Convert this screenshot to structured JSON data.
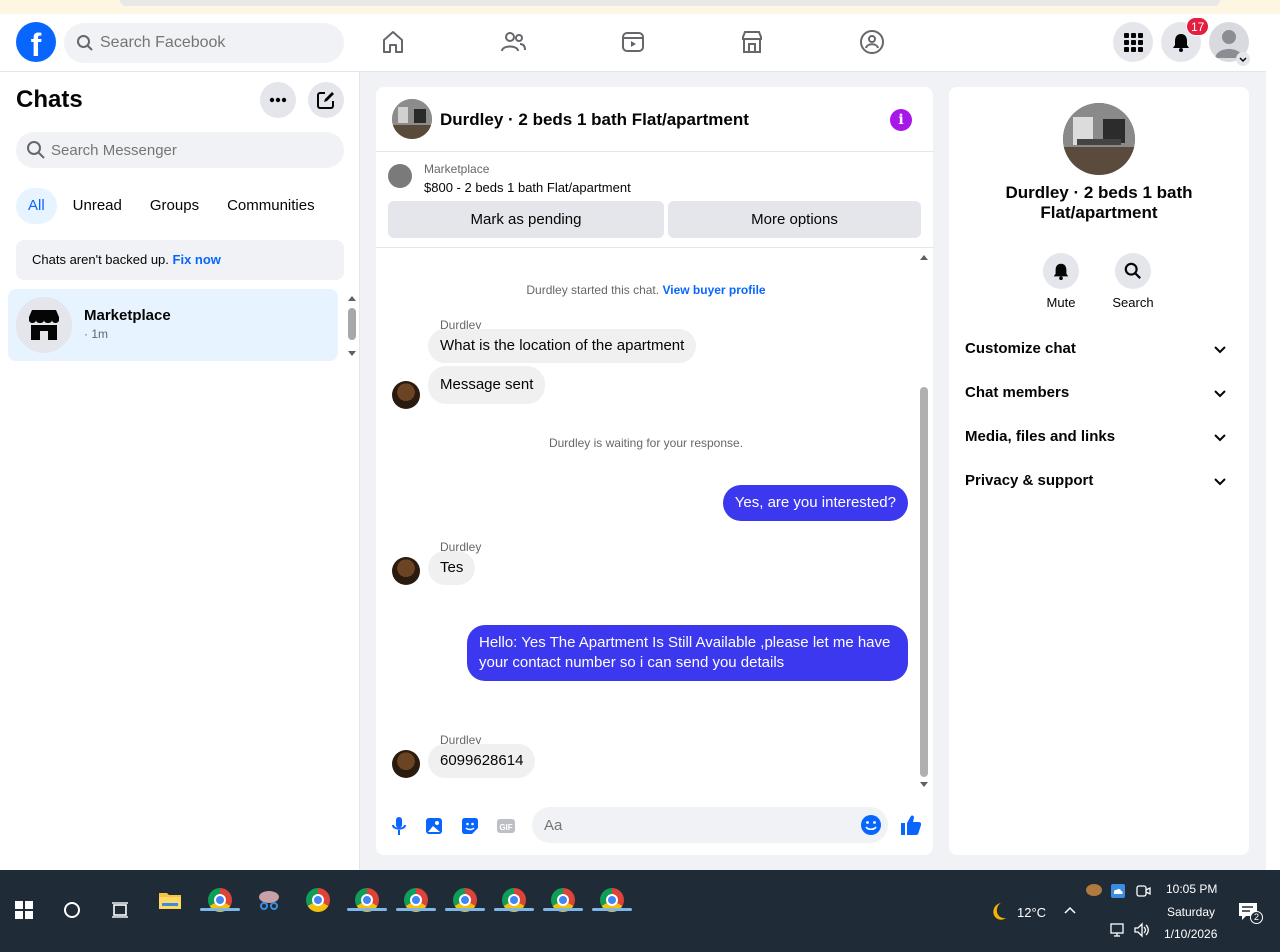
{
  "header": {
    "search_placeholder": "Search Facebook",
    "notifications_count": "17"
  },
  "left": {
    "title": "Chats",
    "search_placeholder": "Search Messenger",
    "filters": [
      "All",
      "Unread",
      "Groups",
      "Communities"
    ],
    "active_filter": "All",
    "backup_text": "Chats aren't backed up.",
    "backup_link": "Fix now",
    "conversation": {
      "name": "Marketplace",
      "time": "· 1m"
    }
  },
  "chat": {
    "title": "Durdley · 2 beds 1 bath Flat/apartment",
    "marketplace_label": "Marketplace",
    "listing_price": "$800 - 2 beds 1 bath Flat/apartment",
    "pending_button": "Mark as pending",
    "options_button": "More options",
    "started_text": "Durdley started this chat.",
    "buyer_profile_link": "View buyer profile",
    "messages": {
      "sender": "Durdley",
      "m1": "What is the location of the apartment",
      "m2": "Message sent",
      "waiting": "Durdley is waiting for your response.",
      "m3": "Yes, are you interested?",
      "m4": "Tes",
      "m5": "Hello: Yes The Apartment Is Still Available ,please let me have your contact number so i can send you details",
      "m6": "6099628614"
    },
    "composer_placeholder": "Aa"
  },
  "right": {
    "title": "Durdley · 2 beds 1 bath Flat/apartment",
    "actions": [
      "Mute",
      "Search"
    ],
    "sections": [
      "Customize chat",
      "Chat members",
      "Media, files and links",
      "Privacy & support"
    ]
  },
  "taskbar": {
    "temperature": "12°C",
    "time": "10:05 PM",
    "day": "Saturday",
    "date": "1/10/2026",
    "notification_count": "2"
  },
  "colors": {
    "brand_blue": "#0866ff",
    "outgoing_bubble": "#3b38f0",
    "info_purple": "#a717e8",
    "badge_red": "#e41e3f"
  }
}
